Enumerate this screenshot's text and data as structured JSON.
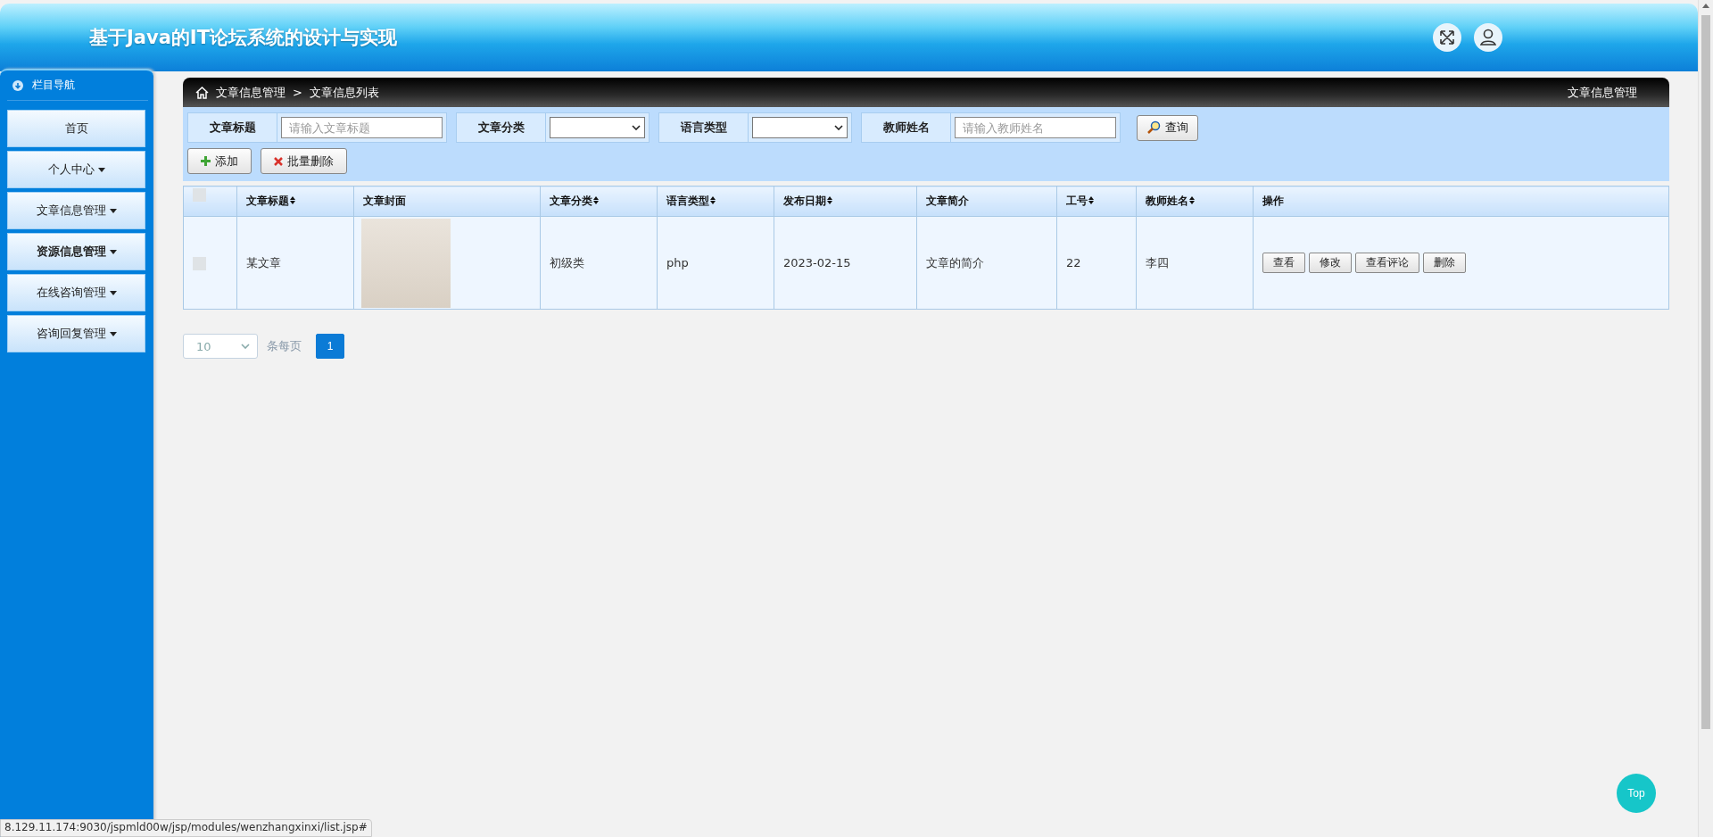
{
  "header": {
    "title": "基于Java的IT论坛系统的设计与实现"
  },
  "sidebar": {
    "title": "栏目导航",
    "items": [
      {
        "label": "首页",
        "dropdown": false,
        "hovered": false
      },
      {
        "label": "个人中心",
        "dropdown": true,
        "hovered": false
      },
      {
        "label": "文章信息管理",
        "dropdown": true,
        "hovered": false
      },
      {
        "label": "资源信息管理",
        "dropdown": true,
        "hovered": true
      },
      {
        "label": "在线咨询管理",
        "dropdown": true,
        "hovered": false
      },
      {
        "label": "咨询回复管理",
        "dropdown": true,
        "hovered": false
      }
    ]
  },
  "breadcrumb": {
    "items": [
      "文章信息管理",
      "文章信息列表"
    ],
    "separator": ">",
    "right_title": "文章信息管理"
  },
  "filters": [
    {
      "kind": "text",
      "label": "文章标题",
      "placeholder": "请输入文章标题"
    },
    {
      "kind": "select",
      "label": "文章分类"
    },
    {
      "kind": "select",
      "label": "语言类型"
    },
    {
      "kind": "text",
      "label": "教师姓名",
      "placeholder": "请输入教师姓名"
    }
  ],
  "search_button": "查询",
  "actions": [
    {
      "kind": "add",
      "label": "添加"
    },
    {
      "kind": "delete",
      "label": "批量删除"
    }
  ],
  "table": {
    "select_all": {
      "checked": false
    },
    "columns": [
      {
        "label": "文章标题",
        "sortable": true
      },
      {
        "label": "文章封面",
        "sortable": false
      },
      {
        "label": "文章分类",
        "sortable": true
      },
      {
        "label": "语言类型",
        "sortable": true
      },
      {
        "label": "发布日期",
        "sortable": true
      },
      {
        "label": "文章简介",
        "sortable": false
      },
      {
        "label": "工号",
        "sortable": true
      },
      {
        "label": "教师姓名",
        "sortable": true
      },
      {
        "label": "操作",
        "sortable": false
      }
    ],
    "rows": [
      {
        "checked": false,
        "cells": [
          {
            "kind": "text",
            "text": "某文章"
          },
          {
            "kind": "image"
          },
          {
            "kind": "text",
            "text": "初级类"
          },
          {
            "kind": "text",
            "text": "php"
          },
          {
            "kind": "text",
            "text": "2023-02-15"
          },
          {
            "kind": "text",
            "text": "文章的简介"
          },
          {
            "kind": "text",
            "text": "22"
          },
          {
            "kind": "text",
            "text": "李四"
          },
          {
            "kind": "buttons",
            "buttons": [
              "查看",
              "修改",
              "查看评论",
              "删除"
            ]
          }
        ]
      }
    ]
  },
  "pagination": {
    "page_size": "10",
    "page_size_label": "条每页",
    "pages": [
      {
        "label": "1",
        "selected": true
      }
    ]
  },
  "top_button": "Top",
  "status_url": "8.129.11.174:9030/jspmld00w/jsp/modules/wenzhangxinxi/list.jsp#"
}
